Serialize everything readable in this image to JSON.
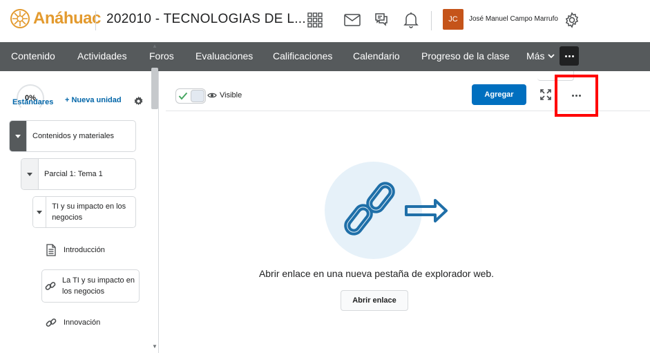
{
  "header": {
    "logo_text": "Anáhuac",
    "course_title": "202010 - TECNOLOGIAS DE L...",
    "avatar_initials": "JC",
    "user_name": "José Manuel Campo Marrufo"
  },
  "nav": {
    "items": [
      "Contenido",
      "Actividades",
      "Foros",
      "Evaluaciones",
      "Calificaciones",
      "Calendario",
      "Progreso de la clase",
      "Más"
    ]
  },
  "sidebar": {
    "progress": "0%",
    "standards_label": "Estándares",
    "new_unit_label": "+ Nueva unidad",
    "tree": {
      "module": "Contenidos y materiales",
      "unit": "Parcial 1: Tema 1",
      "topic": "TI y su impacto en los negocios",
      "leaves": [
        "Introducción",
        "La TI y su impacto en los negocios",
        "Innovación"
      ]
    }
  },
  "content": {
    "visible_label": "Visible",
    "add_button": "Agregar",
    "caption": "Abrir enlace en una nueva pestaña de explorador web.",
    "open_link_button": "Abrir enlace"
  },
  "colors": {
    "brand": "#e39a2e",
    "navbar": "#565a5c",
    "primary_button": "#006fbf",
    "highlight": "#ff0000",
    "avatar": "#c5541a"
  }
}
